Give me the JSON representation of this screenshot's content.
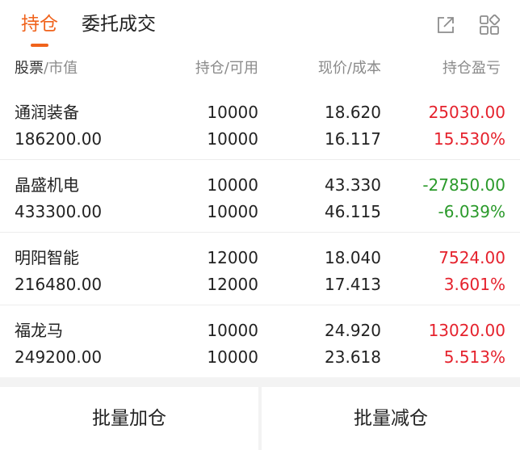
{
  "tabs": [
    {
      "label": "持仓",
      "active": true
    },
    {
      "label": "委托成交",
      "active": false
    }
  ],
  "toolbar": {
    "share_icon": "external-link-icon",
    "grid_icon": "grid-icon"
  },
  "columns": {
    "stock_main": "股票",
    "stock_sub": "/市值",
    "position_main": "持仓",
    "position_sub": "/可用",
    "price_main": "现价",
    "price_sub": "/成本",
    "profit_main": "持仓盈亏"
  },
  "rows": [
    {
      "name": "通润装备",
      "market_value": "186200.00",
      "position": "10000",
      "available": "10000",
      "price": "18.620",
      "cost": "16.117",
      "profit": "25030.00",
      "profit_pct": "15.530%",
      "trend": "up"
    },
    {
      "name": "晶盛机电",
      "market_value": "433300.00",
      "position": "10000",
      "available": "10000",
      "price": "43.330",
      "cost": "46.115",
      "profit": "-27850.00",
      "profit_pct": "-6.039%",
      "trend": "down"
    },
    {
      "name": "明阳智能",
      "market_value": "216480.00",
      "position": "12000",
      "available": "12000",
      "price": "18.040",
      "cost": "17.413",
      "profit": "7524.00",
      "profit_pct": "3.601%",
      "trend": "up"
    },
    {
      "name": "福龙马",
      "market_value": "249200.00",
      "position": "10000",
      "available": "10000",
      "price": "24.920",
      "cost": "23.618",
      "profit": "13020.00",
      "profit_pct": "5.513%",
      "trend": "up"
    }
  ],
  "buttons": {
    "batch_add": "批量加仓",
    "batch_reduce": "批量减仓"
  },
  "colors": {
    "accent": "#f0631c",
    "up": "#e5222d",
    "down": "#2b9a2b"
  }
}
